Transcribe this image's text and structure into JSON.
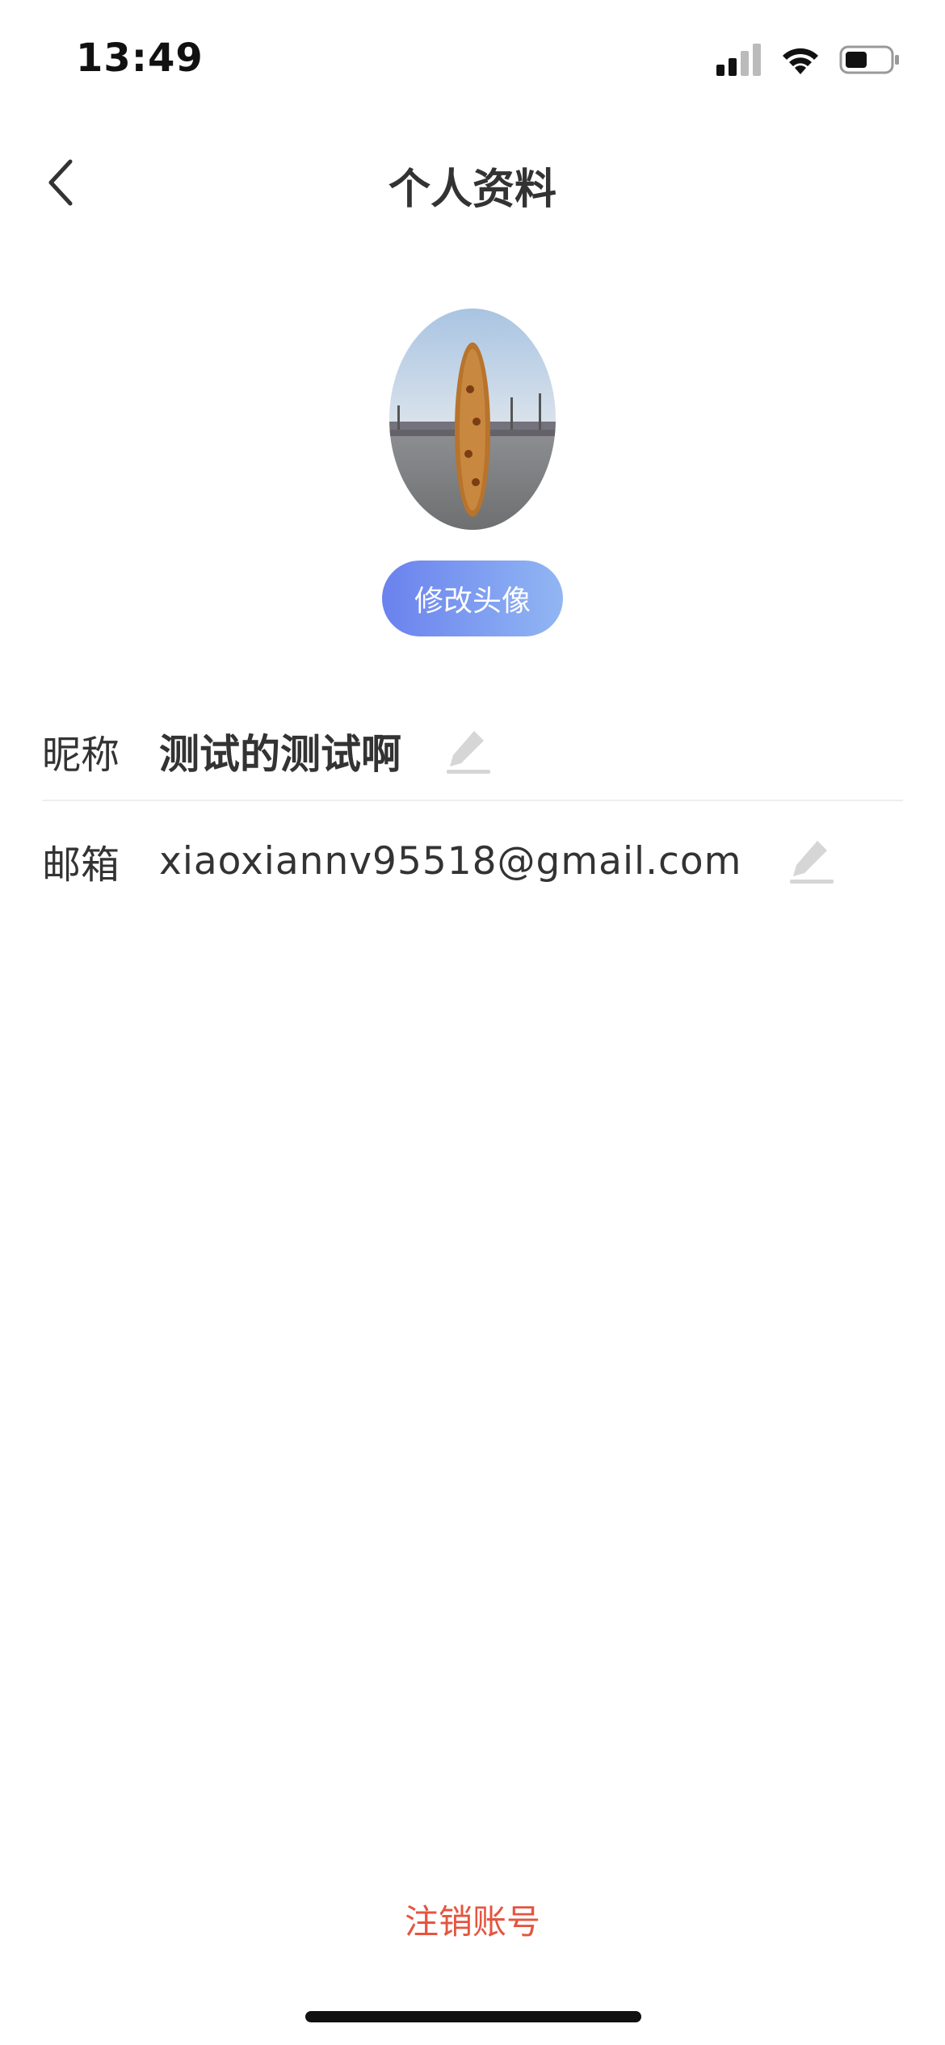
{
  "status_bar": {
    "time": "13:49",
    "icons": [
      "signal-icon",
      "wifi-icon",
      "battery-icon"
    ]
  },
  "header": {
    "title": "个人资料",
    "back_icon": "chevron-left-icon"
  },
  "avatar": {
    "change_label": "修改头像"
  },
  "profile": {
    "nickname_label": "昵称",
    "nickname_value": "测试的测试啊",
    "email_label": "邮箱",
    "email_value": "xiaoxiannv95518@gmail.com",
    "edit_icon": "pencil-icon"
  },
  "footer": {
    "delete_account_label": "注销账号"
  },
  "colors": {
    "accent_start": "#6a82ee",
    "accent_end": "#91b6f3",
    "danger": "#e5553f",
    "text": "#333333",
    "divider": "#eeeeee"
  }
}
